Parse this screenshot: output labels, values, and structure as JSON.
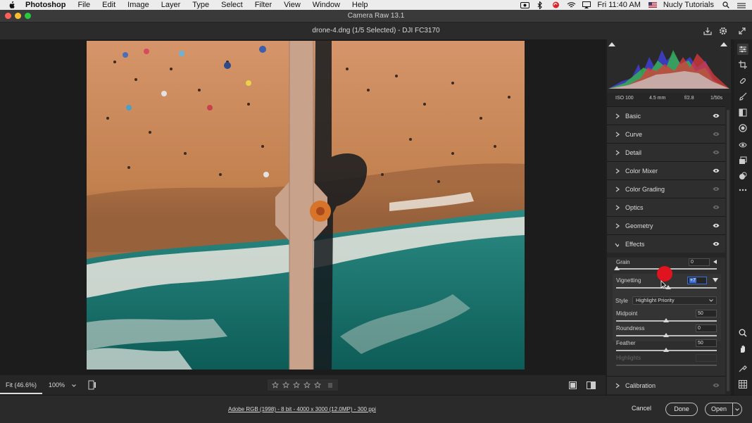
{
  "menubar": {
    "app": "Photoshop",
    "items": [
      "File",
      "Edit",
      "Image",
      "Layer",
      "Type",
      "Select",
      "Filter",
      "View",
      "Window",
      "Help"
    ],
    "clock": "Fri 11:40 AM",
    "user": "Nucly Tutorials"
  },
  "window": {
    "title": "Camera Raw 13.1"
  },
  "file": {
    "header": "drone-4.dng (1/5 Selected)  -  DJI FC3170"
  },
  "exif": {
    "iso": "ISO 100",
    "focal": "4.5 mm",
    "aperture": "f/2.8",
    "shutter": "1/50s"
  },
  "sections": [
    {
      "label": "Basic"
    },
    {
      "label": "Curve"
    },
    {
      "label": "Detail"
    },
    {
      "label": "Color Mixer"
    },
    {
      "label": "Color Grading"
    },
    {
      "label": "Optics"
    },
    {
      "label": "Geometry"
    },
    {
      "label": "Effects"
    }
  ],
  "effects": {
    "grain_label": "Grain",
    "grain_value": "0",
    "grain_level": 0,
    "vignetting_label": "Vignetting",
    "vignetting_value": "+7",
    "style_label": "Style",
    "style_value": "Highlight Priority",
    "midpoint_label": "Midpoint",
    "midpoint_value": "50",
    "roundness_label": "Roundness",
    "roundness_value": "0",
    "feather_label": "Feather",
    "feather_value": "50",
    "highlights_label": "Highlights"
  },
  "calibration": {
    "label": "Calibration"
  },
  "bottom": {
    "fit": "Fit (46.6%)",
    "zoom": "100%"
  },
  "footer": {
    "info": "Adobe RGB (1998) - 8 bit - 4000 x 3000 (12.0MP) - 300 ppi",
    "cancel": "Cancel",
    "done": "Done",
    "open": "Open"
  },
  "colors": {
    "accent": "#3b6fd6",
    "cursor": "#e0141e",
    "panel": "#2e2e2e"
  }
}
